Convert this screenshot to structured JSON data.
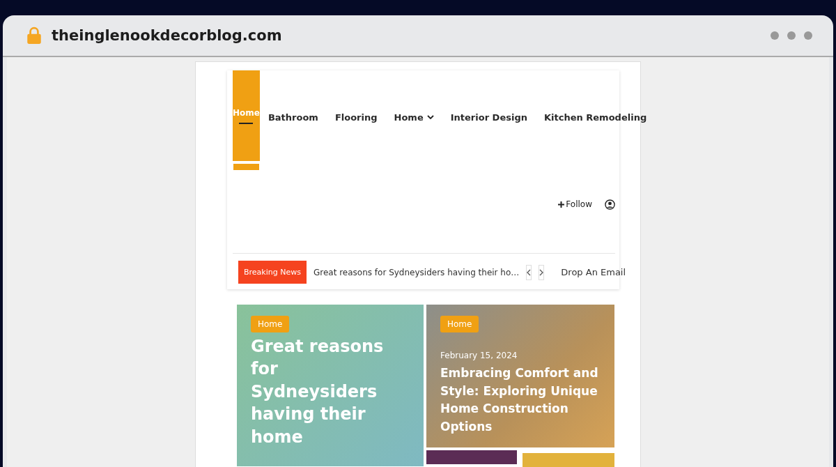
{
  "browser": {
    "url": "theinglenookdecorblog.com"
  },
  "nav": {
    "items": [
      {
        "label": "Home",
        "selected": true,
        "has_dropdown": false
      },
      {
        "label": "Bathroom",
        "selected": false,
        "has_dropdown": false
      },
      {
        "label": "Flooring",
        "selected": false,
        "has_dropdown": false
      },
      {
        "label": "Home",
        "selected": false,
        "has_dropdown": true
      },
      {
        "label": "Interior Design",
        "selected": false,
        "has_dropdown": false
      },
      {
        "label": "Kitchen Remodeling",
        "selected": false,
        "has_dropdown": false
      }
    ],
    "follow": "Follow"
  },
  "breaking_news": {
    "label": "Breaking News",
    "headline": "Great reasons for Sydneysiders having their ho…",
    "email_link": "Drop An Email"
  },
  "featured": [
    {
      "kind": "gradient",
      "category": "Home",
      "title": "Great reasons for Sydneysiders having their home"
    },
    {
      "kind": "photo",
      "category": "Home",
      "date": "February 15, 2024",
      "title": "Embracing Comfort and Style: Exploring Unique Home Construction Options"
    }
  ]
}
